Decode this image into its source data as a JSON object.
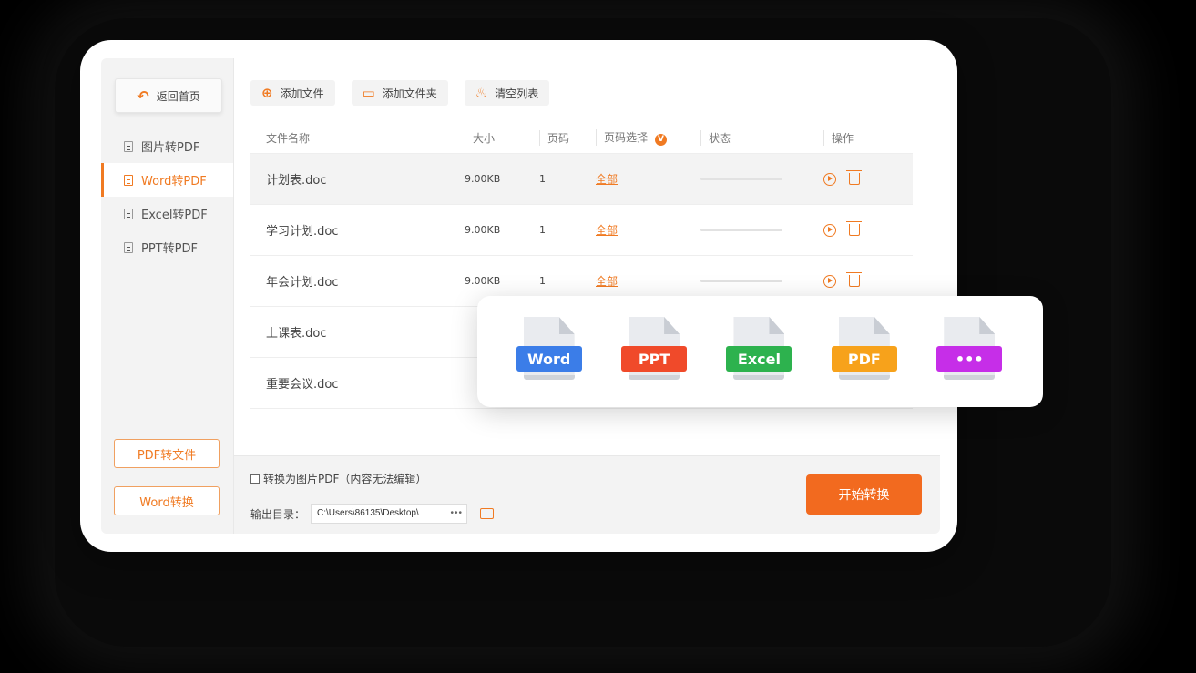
{
  "sidebar": {
    "back_label": "返回首页",
    "items": [
      {
        "label": "图片转PDF",
        "active": false
      },
      {
        "label": "Word转PDF",
        "active": true
      },
      {
        "label": "Excel转PDF",
        "active": false
      },
      {
        "label": "PPT转PDF",
        "active": false
      }
    ],
    "bottom_buttons": [
      "PDF转文件",
      "Word转换"
    ]
  },
  "toolbar": {
    "add_file": "添加文件",
    "add_folder": "添加文件夹",
    "clear_list": "清空列表"
  },
  "table": {
    "headers": {
      "name": "文件名称",
      "size": "大小",
      "pages": "页码",
      "page_select": "页码选择",
      "status": "状态",
      "actions": "操作"
    },
    "page_select_badge": "V",
    "rows": [
      {
        "name": "计划表.doc",
        "size": "9.00KB",
        "pages": "1",
        "select": "全部"
      },
      {
        "name": "学习计划.doc",
        "size": "9.00KB",
        "pages": "1",
        "select": "全部"
      },
      {
        "name": "年会计划.doc",
        "size": "9.00KB",
        "pages": "1",
        "select": "全部"
      },
      {
        "name": "上课表.doc"
      },
      {
        "name": "重要会议.doc"
      }
    ]
  },
  "footer": {
    "convert_image_pdf": "转换为图片PDF（内容无法编辑）",
    "output_label": "输出目录：",
    "output_path": "C:\\Users\\86135\\Desktop\\",
    "browse_dots": "•••",
    "start_button": "开始转换"
  },
  "formats": [
    {
      "label": "Word",
      "color": "#3b7de8"
    },
    {
      "label": "PPT",
      "color": "#f04a2a"
    },
    {
      "label": "Excel",
      "color": "#2db24e"
    },
    {
      "label": "PDF",
      "color": "#f7a21b"
    },
    {
      "label": "•••",
      "color": "#c62ee8"
    }
  ],
  "colors": {
    "accent": "#f07a22",
    "start_button": "#f26a1f"
  }
}
